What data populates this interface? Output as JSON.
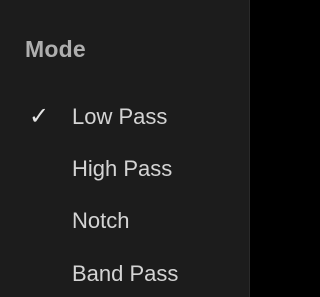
{
  "menu": {
    "header": "Mode",
    "items": [
      {
        "label": "Low Pass",
        "checked": true
      },
      {
        "label": "High Pass",
        "checked": false
      },
      {
        "label": "Notch",
        "checked": false
      },
      {
        "label": "Band Pass",
        "checked": false
      }
    ],
    "check_glyph": "✓"
  },
  "colors": {
    "background": "#1c1c1c",
    "header_text": "#aeaeae",
    "item_text": "#d4d4d4"
  },
  "icons": {
    "check": "check-icon"
  }
}
